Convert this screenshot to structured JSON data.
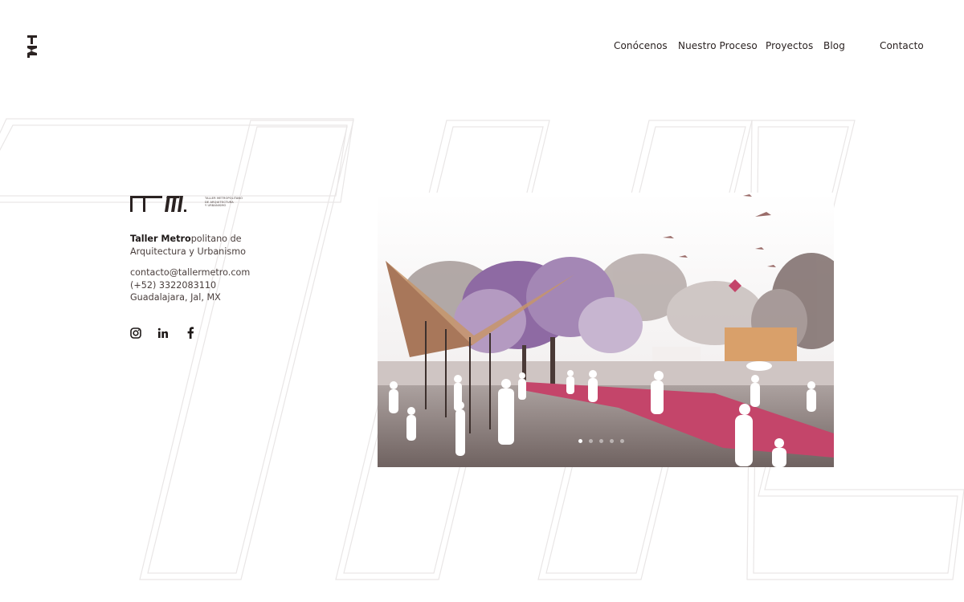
{
  "nav": {
    "items": [
      {
        "label": "Conócenos"
      },
      {
        "label": "Nuestro Proceso"
      },
      {
        "label": "Proyectos"
      },
      {
        "label": "Blog"
      },
      {
        "label": "Contacto"
      }
    ]
  },
  "brand": {
    "logo_text": "TM.",
    "logo_small_lines": [
      "TALLER METROPOLITANO",
      "DE ARQUITECTURA",
      "Y URBANISMO"
    ],
    "name_bold": "Taller Metro",
    "name_rest": "politano de",
    "name_line2": "Arquitectura y Urbanismo"
  },
  "contact": {
    "email": "contacto@tallermetro.com",
    "phone": "(+52) 3322083110",
    "location": "Guadalajara, Jal, MX"
  },
  "social": [
    {
      "icon": "instagram-icon"
    },
    {
      "icon": "linkedin-icon"
    },
    {
      "icon": "facebook-icon"
    }
  ],
  "hero": {
    "slides_count": 5,
    "active_slide": 1
  },
  "colors": {
    "text": "#2a2221",
    "path_pink": "#c4456a",
    "trees_purple": "#8e6aa3",
    "canopy_wood": "#c7956a"
  }
}
